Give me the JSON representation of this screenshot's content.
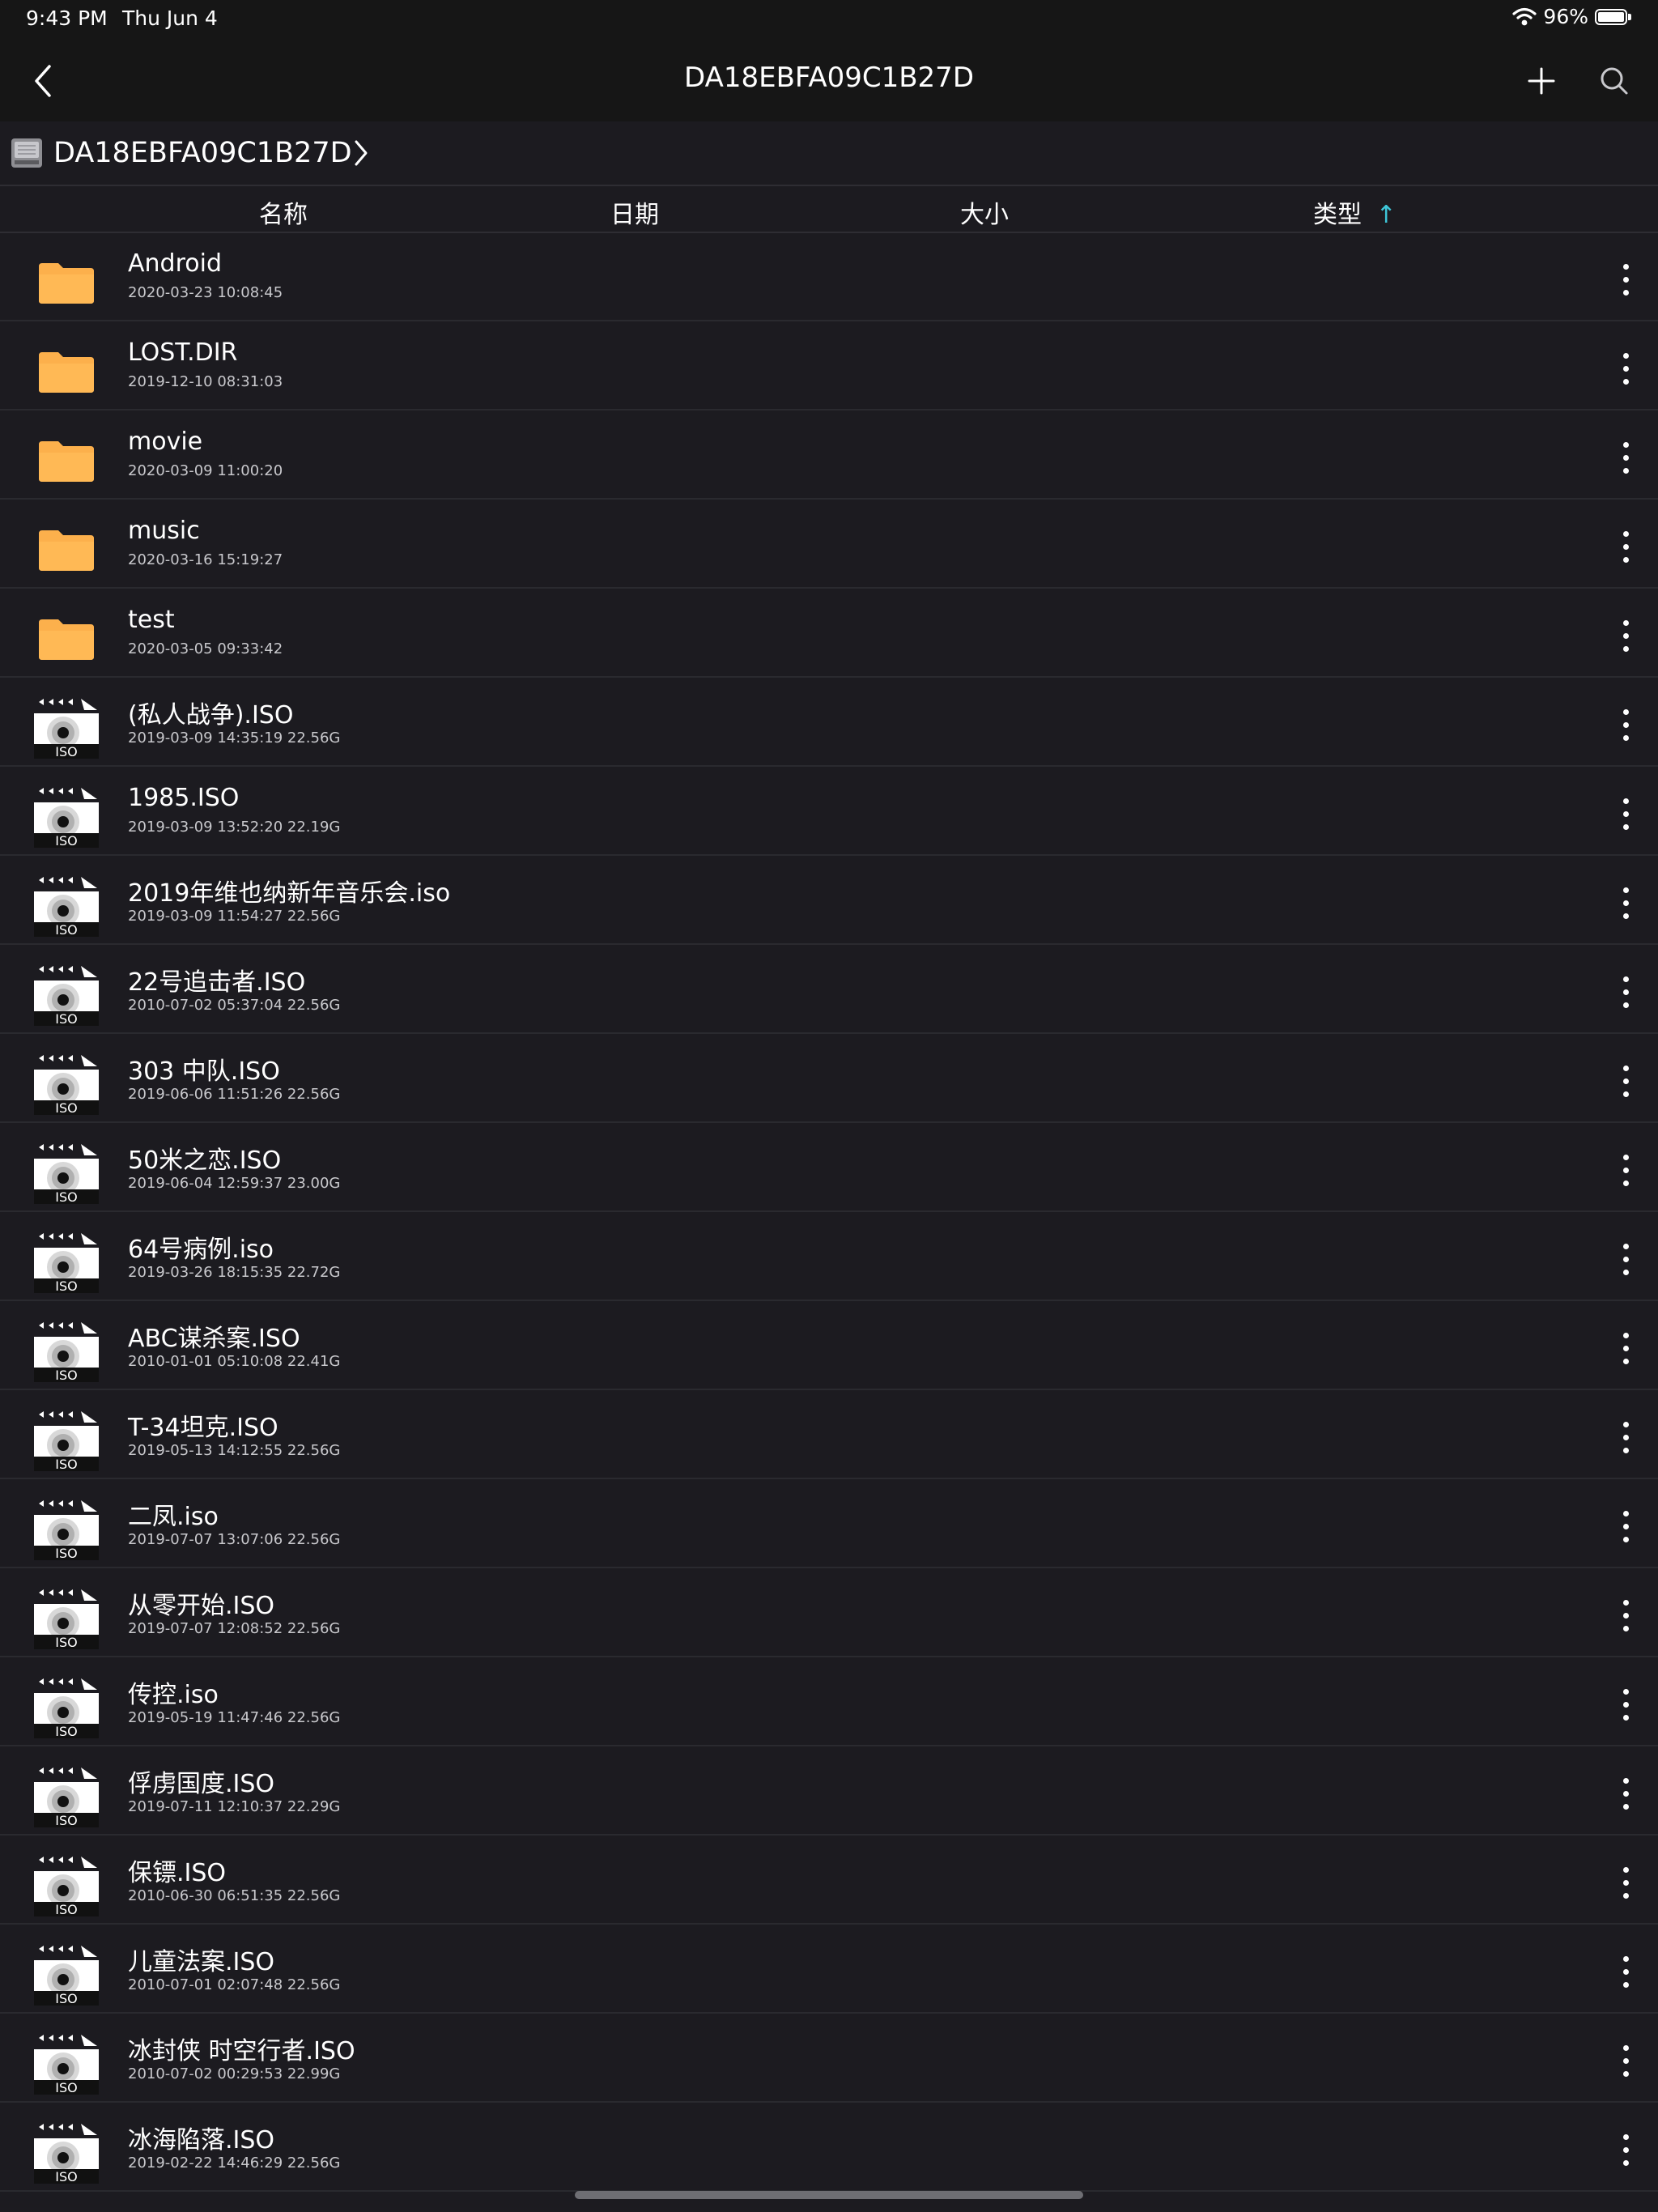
{
  "status": {
    "time": "9:43 PM",
    "date": "Thu Jun 4",
    "battery": "96%"
  },
  "nav": {
    "title": "DA18EBFA09C1B27D"
  },
  "path": {
    "current": "DA18EBFA09C1B27D"
  },
  "columns": {
    "name": "名称",
    "date": "日期",
    "size": "大小",
    "type": "类型",
    "sort_arrow": "↑"
  },
  "colors": {
    "folder": "#fcb04c",
    "accent": "#3ec6d8",
    "background": "#1c1b20"
  },
  "files": [
    {
      "name": "Android",
      "meta": "2020-03-23 10:08:45",
      "icon": "folder-icon"
    },
    {
      "name": "LOST.DIR",
      "meta": "2019-12-10 08:31:03",
      "icon": "folder-icon"
    },
    {
      "name": "movie",
      "meta": "2020-03-09 11:00:20",
      "icon": "folder-icon"
    },
    {
      "name": "music",
      "meta": "2020-03-16 15:19:27",
      "icon": "folder-icon"
    },
    {
      "name": "test",
      "meta": "2020-03-05 09:33:42",
      "icon": "folder-icon"
    },
    {
      "name": "(私人战争).ISO",
      "meta": "2019-03-09 14:35:19 22.56G",
      "icon": "iso-disc-icon"
    },
    {
      "name": "1985.ISO",
      "meta": "2019-03-09 13:52:20 22.19G",
      "icon": "iso-disc-icon"
    },
    {
      "name": "2019年维也纳新年音乐会.iso",
      "meta": "2019-03-09 11:54:27 22.56G",
      "icon": "iso-disc-icon"
    },
    {
      "name": "22号追击者.ISO",
      "meta": "2010-07-02 05:37:04 22.56G",
      "icon": "iso-disc-icon"
    },
    {
      "name": "303 中队.ISO",
      "meta": "2019-06-06 11:51:26 22.56G",
      "icon": "iso-disc-icon"
    },
    {
      "name": "50米之恋.ISO",
      "meta": "2019-06-04 12:59:37 23.00G",
      "icon": "iso-disc-icon"
    },
    {
      "name": "64号病例.iso",
      "meta": "2019-03-26 18:15:35 22.72G",
      "icon": "iso-disc-icon"
    },
    {
      "name": "ABC谋杀案.ISO",
      "meta": "2010-01-01 05:10:08 22.41G",
      "icon": "iso-disc-icon"
    },
    {
      "name": "T-34坦克.ISO",
      "meta": "2019-05-13 14:12:55 22.56G",
      "icon": "iso-disc-icon"
    },
    {
      "name": "二凤.iso",
      "meta": "2019-07-07 13:07:06 22.56G",
      "icon": "iso-disc-icon"
    },
    {
      "name": "从零开始.ISO",
      "meta": "2019-07-07 12:08:52 22.56G",
      "icon": "iso-disc-icon"
    },
    {
      "name": "传控.iso",
      "meta": "2019-05-19 11:47:46 22.56G",
      "icon": "iso-disc-icon"
    },
    {
      "name": "俘虏国度.ISO",
      "meta": "2019-07-11 12:10:37 22.29G",
      "icon": "iso-disc-icon"
    },
    {
      "name": "保镖.ISO",
      "meta": "2010-06-30 06:51:35 22.56G",
      "icon": "iso-disc-icon"
    },
    {
      "name": "儿童法案.ISO",
      "meta": "2010-07-01 02:07:48 22.56G",
      "icon": "iso-disc-icon"
    },
    {
      "name": "冰封侠 时空行者.ISO",
      "meta": "2010-07-02 00:29:53 22.99G",
      "icon": "iso-disc-icon"
    },
    {
      "name": "冰海陷落.ISO",
      "meta": "2019-02-22 14:46:29 22.56G",
      "icon": "iso-disc-icon"
    }
  ]
}
